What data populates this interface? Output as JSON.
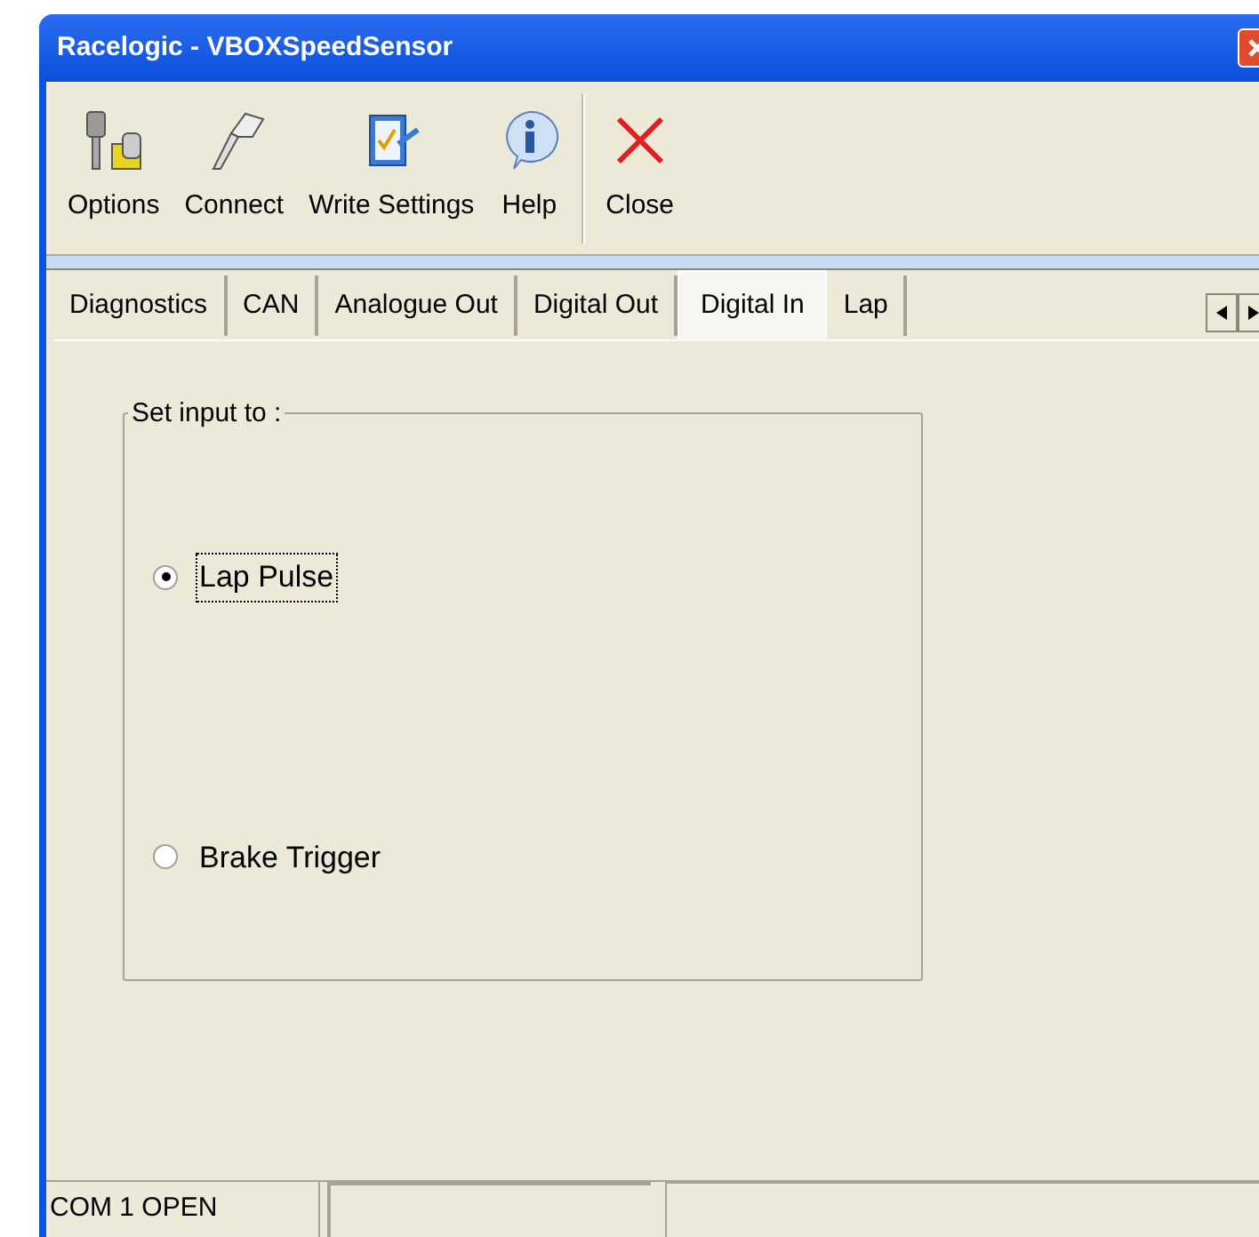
{
  "window": {
    "title": "Racelogic - VBOXSpeedSensor"
  },
  "toolbar": [
    {
      "label": "Options",
      "kind": "options"
    },
    {
      "label": "Connect",
      "kind": "connect"
    },
    {
      "label": "Write Settings",
      "kind": "write"
    },
    {
      "label": "Help",
      "kind": "help"
    },
    {
      "label": "Close",
      "kind": "close"
    }
  ],
  "tabs": [
    {
      "label": "Diagnostics",
      "selected": false
    },
    {
      "label": "CAN",
      "selected": false
    },
    {
      "label": "Analogue Out",
      "selected": false
    },
    {
      "label": "Digital Out",
      "selected": false
    },
    {
      "label": "Digital In",
      "selected": true
    },
    {
      "label": "Lap",
      "selected": false
    }
  ],
  "group": {
    "title": "Set input to :",
    "options": [
      {
        "label": "Lap Pulse",
        "selected": true
      },
      {
        "label": "Brake Trigger",
        "selected": false
      }
    ]
  },
  "status_bar": {
    "panel_1": "COM 1 OPEN"
  }
}
